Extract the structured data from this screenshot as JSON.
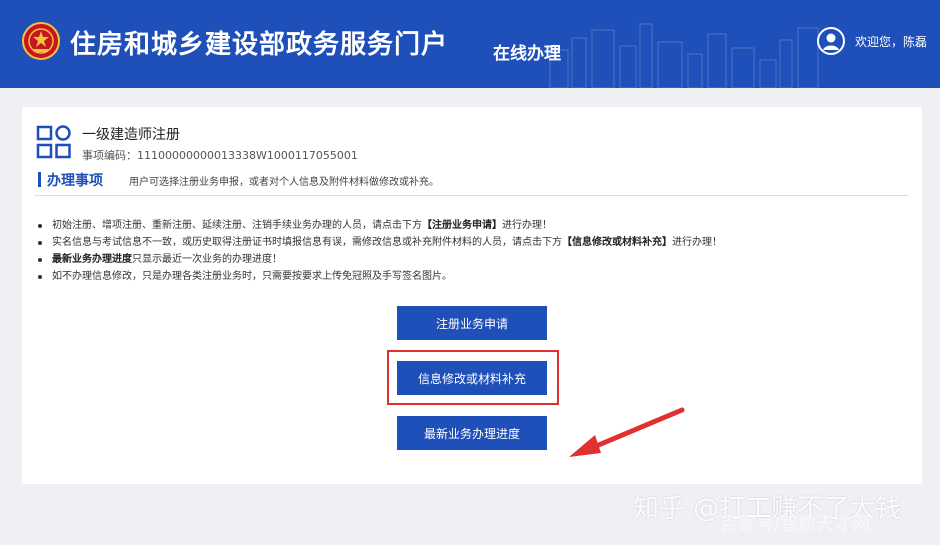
{
  "header": {
    "site_title": "住房和城乡建设部政务服务门户",
    "online_label": "在线办理",
    "welcome_text": "欢迎您，陈磊",
    "bg_color": "#1f4fb8",
    "emblem_icon": "national-emblem-icon",
    "user_icon": "user-avatar-icon"
  },
  "item": {
    "icon": "grid-apps-icon",
    "title": "一级建造师注册",
    "code_text": "事项编码：11100000000013338W1000117055001"
  },
  "section": {
    "title": "办理事项",
    "desc": "用户可选择注册业务申报，或者对个人信息及附件材料做修改或补充。"
  },
  "notes": [
    {
      "pre": "初始注册、增项注册、重新注册、延续注册、注销手续业务办理的人员，请点击下方",
      "bold": "【注册业务申请】",
      "post": "进行办理！"
    },
    {
      "pre": "实名信息与考试信息不一致，或历史取得注册证书时填报信息有误，需修改信息或补充附件材料的人员，请点击下方",
      "bold": "【信息修改或材料补充】",
      "post": "进行办理！"
    },
    {
      "pre": "",
      "bold": "最新业务办理进度",
      "post": "只显示最近一次业务的办理进度！"
    },
    {
      "pre": "如不办理信息修改，只是办理各类注册业务时，只需要按要求上传免冠照及手写签名图片。",
      "bold": "",
      "post": ""
    }
  ],
  "buttons": {
    "register": "注册业务申请",
    "modify": "信息修改或材料补充",
    "progress": "最新业务办理进度"
  },
  "annotation": {
    "highlight_color": "#e0302f"
  },
  "watermark": {
    "main": "知乎 @打工赚不了大钱",
    "sub": "百家号/智质天才网"
  }
}
